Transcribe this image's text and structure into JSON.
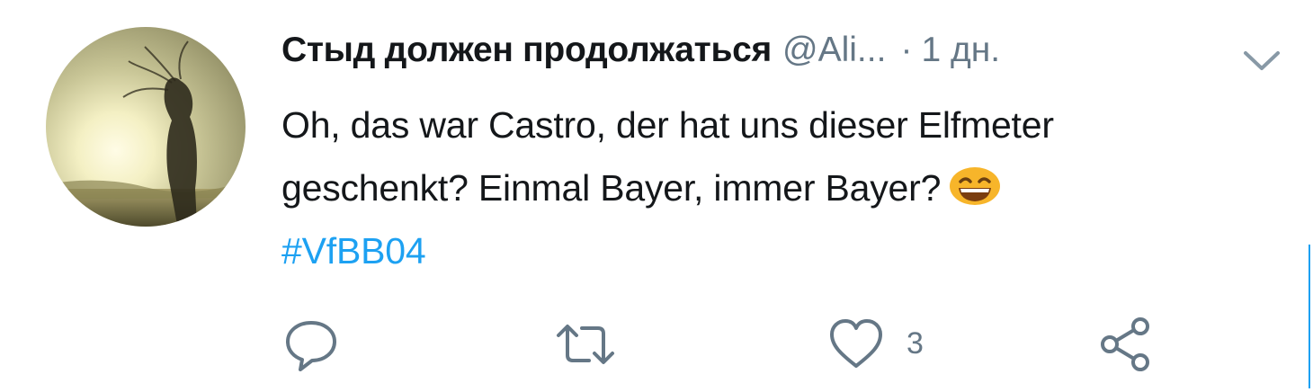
{
  "tweet": {
    "display_name": "Стыд должен продолжаться",
    "handle": "@Ali...",
    "separator": "·",
    "time": "1 дн.",
    "text_line1": "Oh, das war Castro, der hat uns dieser Elfmeter",
    "text_line2": "geschenkt? Einmal Bayer, immer Bayer?",
    "emoji": "smiling-face-emoji",
    "hashtag": "#VfBB04"
  },
  "actions": {
    "reply_icon": "reply-icon",
    "retweet_icon": "retweet-icon",
    "like_icon": "heart-icon",
    "like_count": "3",
    "share_icon": "share-icon"
  },
  "colors": {
    "text": "#14171a",
    "secondary": "#657786",
    "link": "#1da1f2"
  }
}
